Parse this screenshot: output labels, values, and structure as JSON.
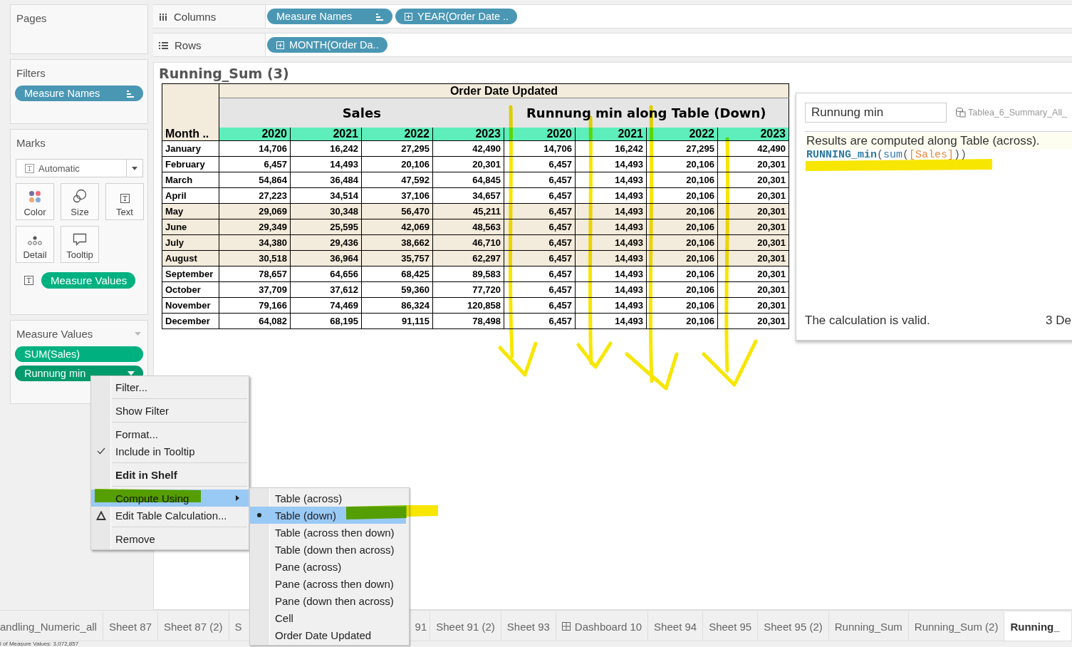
{
  "shelves": [
    {
      "label": "Columns",
      "pills": [
        {
          "label": "Measure Names",
          "kind": "measure_names"
        },
        {
          "label": "YEAR(Order Date ..",
          "kind": "date"
        }
      ]
    },
    {
      "label": "Rows",
      "pills": [
        {
          "label": "MONTH(Order Da..",
          "kind": "date"
        }
      ]
    }
  ],
  "left_panel": {
    "pages": {
      "title": "Pages"
    },
    "filters": {
      "title": "Filters",
      "pills": [
        {
          "label": "Measure Names",
          "kind": "measure_names"
        }
      ]
    },
    "marks": {
      "title": "Marks",
      "mark_type": "Automatic",
      "buttons": [
        {
          "label": "Color"
        },
        {
          "label": "Size"
        },
        {
          "label": "Text"
        },
        {
          "label": "Detail"
        },
        {
          "label": "Tooltip"
        }
      ],
      "pills": [
        {
          "label": "Measure Values",
          "kind": "measure"
        }
      ]
    },
    "measure_values": {
      "title": "Measure Values",
      "pills": [
        {
          "label": "SUM(Sales)",
          "kind": "measure",
          "selected": false
        },
        {
          "label": "Runnung min",
          "kind": "measure",
          "selected": true
        }
      ]
    }
  },
  "view": {
    "title": "Running_Sum (3)",
    "table": {
      "top_header": "Order Date Updated",
      "corner": "Month ..",
      "groups": [
        {
          "label": "Sales",
          "years": [
            "2020",
            "2021",
            "2022",
            "2023"
          ]
        },
        {
          "label": "Runnung min along Table (Down)",
          "years": [
            "2020",
            "2021",
            "2022",
            "2023"
          ]
        }
      ],
      "rows": [
        {
          "month": "January",
          "shaded": false,
          "values": [
            "14,706",
            "16,242",
            "27,295",
            "42,490",
            "14,706",
            "16,242",
            "27,295",
            "42,490"
          ]
        },
        {
          "month": "February",
          "shaded": false,
          "values": [
            "6,457",
            "14,493",
            "20,106",
            "20,301",
            "6,457",
            "14,493",
            "20,106",
            "20,301"
          ]
        },
        {
          "month": "March",
          "shaded": false,
          "values": [
            "54,864",
            "36,484",
            "47,592",
            "64,845",
            "6,457",
            "14,493",
            "20,106",
            "20,301"
          ]
        },
        {
          "month": "April",
          "shaded": false,
          "values": [
            "27,223",
            "34,514",
            "37,106",
            "34,657",
            "6,457",
            "14,493",
            "20,106",
            "20,301"
          ]
        },
        {
          "month": "May",
          "shaded": true,
          "values": [
            "29,069",
            "30,348",
            "56,470",
            "45,211",
            "6,457",
            "14,493",
            "20,106",
            "20,301"
          ]
        },
        {
          "month": "June",
          "shaded": true,
          "values": [
            "29,349",
            "25,595",
            "42,069",
            "48,563",
            "6,457",
            "14,493",
            "20,106",
            "20,301"
          ]
        },
        {
          "month": "July",
          "shaded": true,
          "values": [
            "34,380",
            "29,436",
            "38,662",
            "46,710",
            "6,457",
            "14,493",
            "20,106",
            "20,301"
          ]
        },
        {
          "month": "August",
          "shaded": true,
          "values": [
            "30,518",
            "36,964",
            "35,757",
            "62,297",
            "6,457",
            "14,493",
            "20,106",
            "20,301"
          ]
        },
        {
          "month": "September",
          "shaded": false,
          "values": [
            "78,657",
            "64,656",
            "68,425",
            "89,583",
            "6,457",
            "14,493",
            "20,106",
            "20,301"
          ]
        },
        {
          "month": "October",
          "shaded": false,
          "values": [
            "37,709",
            "37,612",
            "59,360",
            "77,720",
            "6,457",
            "14,493",
            "20,106",
            "20,301"
          ]
        },
        {
          "month": "November",
          "shaded": false,
          "values": [
            "79,166",
            "74,469",
            "86,324",
            "120,858",
            "6,457",
            "14,493",
            "20,106",
            "20,301"
          ]
        },
        {
          "month": "December",
          "shaded": false,
          "values": [
            "64,082",
            "68,195",
            "91,115",
            "78,498",
            "6,457",
            "14,493",
            "20,106",
            "20,301"
          ]
        }
      ]
    }
  },
  "calc_editor": {
    "name": "Runnung min",
    "datasource": "Tablea_6_Summary_All_",
    "message": "Results are computed along Table (across).",
    "formula": [
      {
        "text": "RUNNING_min",
        "kind": "function"
      },
      {
        "text": "(",
        "kind": "paren"
      },
      {
        "text": "sum",
        "kind": "aggregate"
      },
      {
        "text": "(",
        "kind": "paren"
      },
      {
        "text": "[Sales]",
        "kind": "field"
      },
      {
        "text": "))",
        "kind": "paren"
      }
    ],
    "status": "The calculation is valid.",
    "dependencies": "3 De"
  },
  "context_menu": {
    "groups": [
      [
        {
          "label": "Filter...",
          "checked": false,
          "selected": false,
          "bold": false,
          "submenu": false
        }
      ],
      [
        {
          "label": "Show Filter",
          "checked": false,
          "selected": false,
          "bold": false,
          "submenu": false
        }
      ],
      [
        {
          "label": "Format...",
          "checked": false,
          "selected": false,
          "bold": false,
          "submenu": false
        },
        {
          "label": "Include in Tooltip",
          "checked": true,
          "selected": false,
          "bold": false,
          "submenu": false
        }
      ],
      [
        {
          "label": "Edit in Shelf",
          "checked": false,
          "selected": false,
          "bold": true,
          "submenu": false
        }
      ],
      [
        {
          "label": "Compute Using",
          "checked": false,
          "selected": true,
          "bold": false,
          "submenu": true
        },
        {
          "label": "Edit Table Calculation...",
          "checked": false,
          "selected": false,
          "bold": false,
          "submenu": false,
          "kind": "table_calc"
        }
      ],
      [
        {
          "label": "Remove",
          "checked": false,
          "selected": false,
          "bold": false,
          "submenu": false
        }
      ]
    ]
  },
  "submenu": {
    "items": [
      {
        "label": "Table (across)",
        "selected": false
      },
      {
        "label": "Table (down)",
        "selected": true
      },
      {
        "label": "Table (across then down)",
        "selected": false
      },
      {
        "label": "Table (down then across)",
        "selected": false
      },
      {
        "label": "Pane (across)",
        "selected": false
      },
      {
        "label": "Pane (across then down)",
        "selected": false
      },
      {
        "label": "Pane (down then across)",
        "selected": false
      },
      {
        "label": "Cell",
        "selected": false
      },
      {
        "label": "Order Date Updated",
        "selected": false
      }
    ]
  },
  "sheet_tabs": [
    {
      "label": "andling_Numeric_all",
      "kind": "sheet",
      "selected": false
    },
    {
      "label": "Sheet 87",
      "kind": "sheet",
      "selected": false
    },
    {
      "label": "Sheet 87 (2)",
      "kind": "sheet",
      "selected": false
    },
    {
      "label": "S",
      "kind": "sheet",
      "selected": false
    },
    {
      "label": "91",
      "kind": "sheet",
      "selected": false
    },
    {
      "label": "Sheet 91 (2)",
      "kind": "sheet",
      "selected": false
    },
    {
      "label": "Sheet 93",
      "kind": "sheet",
      "selected": false
    },
    {
      "label": "Dashboard 10",
      "kind": "dashboard",
      "selected": false
    },
    {
      "label": "Sheet 94",
      "kind": "sheet",
      "selected": false
    },
    {
      "label": "Sheet 95",
      "kind": "sheet",
      "selected": false
    },
    {
      "label": "Sheet 95 (2)",
      "kind": "sheet",
      "selected": false
    },
    {
      "label": "Running_Sum",
      "kind": "sheet",
      "selected": false
    },
    {
      "label": "Running_Sum (2)",
      "kind": "sheet",
      "selected": false
    },
    {
      "label": "Running_",
      "kind": "sheet",
      "selected": true
    }
  ],
  "status_bar": "l of Measure Values: 3,072,857"
}
